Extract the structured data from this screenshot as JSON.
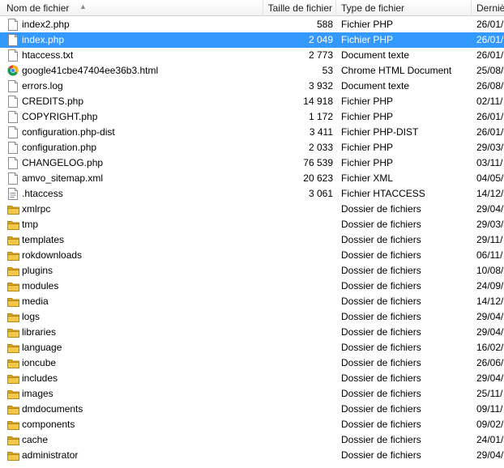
{
  "header": {
    "name": "Nom de fichier",
    "size": "Taille de fichier",
    "type": "Type de fichier",
    "date": "Derniè"
  },
  "files": [
    {
      "name": "index2.php",
      "size": "588",
      "type": "Fichier PHP",
      "date": "26/01/",
      "icon": "file-icon"
    },
    {
      "name": "index.php",
      "size": "2 049",
      "type": "Fichier PHP",
      "date": "26/01/",
      "icon": "file-icon",
      "selected": true
    },
    {
      "name": "htaccess.txt",
      "size": "2 773",
      "type": "Document texte",
      "date": "26/01/",
      "icon": "file-icon"
    },
    {
      "name": "google41cbe47404ee36b3.html",
      "size": "53",
      "type": "Chrome HTML Document",
      "date": "25/08/",
      "icon": "chrome-icon"
    },
    {
      "name": "errors.log",
      "size": "3 932",
      "type": "Document texte",
      "date": "26/08/",
      "icon": "file-icon"
    },
    {
      "name": "CREDITS.php",
      "size": "14 918",
      "type": "Fichier PHP",
      "date": "02/11/",
      "icon": "file-icon"
    },
    {
      "name": "COPYRIGHT.php",
      "size": "1 172",
      "type": "Fichier PHP",
      "date": "26/01/",
      "icon": "file-icon"
    },
    {
      "name": "configuration.php-dist",
      "size": "3 411",
      "type": "Fichier PHP-DIST",
      "date": "26/01/",
      "icon": "file-icon"
    },
    {
      "name": "configuration.php",
      "size": "2 033",
      "type": "Fichier PHP",
      "date": "29/03/",
      "icon": "file-icon"
    },
    {
      "name": "CHANGELOG.php",
      "size": "76 539",
      "type": "Fichier PHP",
      "date": "03/11/",
      "icon": "file-icon"
    },
    {
      "name": "amvo_sitemap.xml",
      "size": "20 623",
      "type": "Fichier XML",
      "date": "04/05/",
      "icon": "file-icon"
    },
    {
      "name": ".htaccess",
      "size": "3 061",
      "type": "Fichier HTACCESS",
      "date": "14/12/",
      "icon": "config-file-icon"
    },
    {
      "name": "xmlrpc",
      "size": "",
      "type": "Dossier de fichiers",
      "date": "29/04/",
      "icon": "folder-icon"
    },
    {
      "name": "tmp",
      "size": "",
      "type": "Dossier de fichiers",
      "date": "29/03/",
      "icon": "folder-icon"
    },
    {
      "name": "templates",
      "size": "",
      "type": "Dossier de fichiers",
      "date": "29/11/",
      "icon": "folder-icon"
    },
    {
      "name": "rokdownloads",
      "size": "",
      "type": "Dossier de fichiers",
      "date": "06/11/",
      "icon": "folder-icon"
    },
    {
      "name": "plugins",
      "size": "",
      "type": "Dossier de fichiers",
      "date": "10/08/",
      "icon": "folder-icon"
    },
    {
      "name": "modules",
      "size": "",
      "type": "Dossier de fichiers",
      "date": "24/09/",
      "icon": "folder-icon"
    },
    {
      "name": "media",
      "size": "",
      "type": "Dossier de fichiers",
      "date": "14/12/",
      "icon": "folder-icon"
    },
    {
      "name": "logs",
      "size": "",
      "type": "Dossier de fichiers",
      "date": "29/04/",
      "icon": "folder-icon"
    },
    {
      "name": "libraries",
      "size": "",
      "type": "Dossier de fichiers",
      "date": "29/04/",
      "icon": "folder-icon"
    },
    {
      "name": "language",
      "size": "",
      "type": "Dossier de fichiers",
      "date": "16/02/",
      "icon": "folder-icon"
    },
    {
      "name": "ioncube",
      "size": "",
      "type": "Dossier de fichiers",
      "date": "26/06/",
      "icon": "folder-icon"
    },
    {
      "name": "includes",
      "size": "",
      "type": "Dossier de fichiers",
      "date": "29/04/",
      "icon": "folder-icon"
    },
    {
      "name": "images",
      "size": "",
      "type": "Dossier de fichiers",
      "date": "25/11/",
      "icon": "folder-icon"
    },
    {
      "name": "dmdocuments",
      "size": "",
      "type": "Dossier de fichiers",
      "date": "09/11/",
      "icon": "folder-icon"
    },
    {
      "name": "components",
      "size": "",
      "type": "Dossier de fichiers",
      "date": "09/02/",
      "icon": "folder-icon"
    },
    {
      "name": "cache",
      "size": "",
      "type": "Dossier de fichiers",
      "date": "24/01/",
      "icon": "folder-icon"
    },
    {
      "name": "administrator",
      "size": "",
      "type": "Dossier de fichiers",
      "date": "29/04/",
      "icon": "folder-icon"
    }
  ],
  "colors": {
    "selection": "#3399ff",
    "folder": "#e8b93a",
    "file_border": "#8c8c8c"
  }
}
